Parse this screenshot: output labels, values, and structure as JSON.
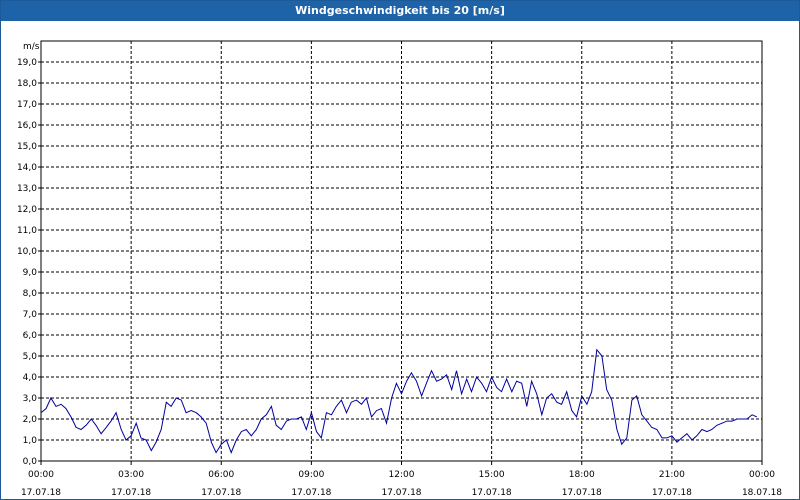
{
  "window": {
    "title": "Windgeschwindigkeit bis 20 [m/s]"
  },
  "chart_data": {
    "type": "line",
    "title": "Windgeschwindigkeit bis 20 [m/s]",
    "ylabel": "m/s",
    "ylim": [
      0,
      20
    ],
    "xlim_hours": [
      0,
      24
    ],
    "grid": true,
    "y_ticks": [
      "0,0",
      "1,0",
      "2,0",
      "3,0",
      "4,0",
      "5,0",
      "6,0",
      "7,0",
      "8,0",
      "9,0",
      "10,0",
      "11,0",
      "12,0",
      "13,0",
      "14,0",
      "15,0",
      "16,0",
      "17,0",
      "18,0",
      "19,0"
    ],
    "x_ticks": [
      {
        "time": "00:00",
        "date": "17.07.18"
      },
      {
        "time": "03:00",
        "date": "17.07.18"
      },
      {
        "time": "06:00",
        "date": "17.07.18"
      },
      {
        "time": "09:00",
        "date": "17.07.18"
      },
      {
        "time": "12:00",
        "date": "17.07.18"
      },
      {
        "time": "15:00",
        "date": "17.07.18"
      },
      {
        "time": "18:00",
        "date": "17.07.18"
      },
      {
        "time": "21:00",
        "date": "17.07.18"
      },
      {
        "time": "00:00",
        "date": "18.07.18"
      }
    ],
    "series": [
      {
        "color": "#0000a0",
        "x_hours": [
          0,
          0.17,
          0.33,
          0.5,
          0.67,
          0.83,
          1,
          1.17,
          1.33,
          1.5,
          1.67,
          1.83,
          2,
          2.17,
          2.33,
          2.5,
          2.67,
          2.83,
          3,
          3.17,
          3.33,
          3.5,
          3.67,
          3.83,
          4,
          4.17,
          4.33,
          4.5,
          4.67,
          4.83,
          5,
          5.17,
          5.33,
          5.5,
          5.67,
          5.83,
          6,
          6.17,
          6.33,
          6.5,
          6.67,
          6.83,
          7,
          7.17,
          7.33,
          7.5,
          7.67,
          7.83,
          8,
          8.17,
          8.33,
          8.5,
          8.67,
          8.83,
          9,
          9.17,
          9.33,
          9.5,
          9.67,
          9.83,
          10,
          10.17,
          10.33,
          10.5,
          10.67,
          10.83,
          11,
          11.17,
          11.33,
          11.5,
          11.67,
          11.83,
          12,
          12.17,
          12.33,
          12.5,
          12.67,
          12.83,
          13,
          13.17,
          13.33,
          13.5,
          13.67,
          13.83,
          14,
          14.17,
          14.33,
          14.5,
          14.67,
          14.83,
          15,
          15.17,
          15.33,
          15.5,
          15.67,
          15.83,
          16,
          16.17,
          16.33,
          16.5,
          16.67,
          16.83,
          17,
          17.17,
          17.33,
          17.5,
          17.67,
          17.83,
          18,
          18.17,
          18.33,
          18.5,
          18.67,
          18.83,
          19,
          19.17,
          19.33,
          19.5,
          19.67,
          19.83,
          20,
          20.17,
          20.33,
          20.5,
          20.67,
          20.83,
          21,
          21.17,
          21.33,
          21.5,
          21.67,
          21.83,
          22,
          22.17,
          22.33,
          22.5,
          22.67,
          22.83,
          23,
          23.17,
          23.33,
          23.5,
          23.67,
          23.83
        ],
        "values": [
          2.3,
          2.5,
          3.0,
          2.6,
          2.7,
          2.5,
          2.1,
          1.6,
          1.5,
          1.7,
          2.0,
          1.7,
          1.3,
          1.6,
          1.9,
          2.3,
          1.5,
          1.0,
          1.2,
          1.8,
          1.1,
          1.0,
          0.5,
          0.9,
          1.5,
          2.8,
          2.6,
          3.0,
          2.9,
          2.3,
          2.4,
          2.3,
          2.1,
          1.8,
          0.9,
          0.4,
          0.8,
          1.0,
          0.4,
          1.0,
          1.4,
          1.5,
          1.2,
          1.5,
          2.0,
          2.2,
          2.6,
          1.7,
          1.5,
          1.9,
          2.0,
          2.0,
          2.1,
          1.5,
          2.3,
          1.4,
          1.1,
          2.3,
          2.2,
          2.6,
          2.9,
          2.3,
          2.8,
          2.9,
          2.7,
          3.0,
          2.1,
          2.4,
          2.5,
          1.8,
          3.0,
          3.7,
          3.2,
          3.8,
          4.2,
          3.8,
          3.1,
          3.7,
          4.3,
          3.8,
          3.9,
          4.1,
          3.4,
          4.3,
          3.2,
          3.9,
          3.3,
          4.0,
          3.7,
          3.3,
          4.0,
          3.5,
          3.3,
          3.9,
          3.3,
          3.8,
          3.7,
          2.6,
          3.8,
          3.2,
          2.2,
          3.0,
          3.2,
          2.8,
          2.7,
          3.3,
          2.4,
          2.1,
          3.1,
          2.7,
          3.3,
          5.3,
          5.0,
          3.4,
          2.9,
          1.5,
          0.8,
          1.1,
          2.9,
          3.1,
          2.2,
          1.9,
          1.6,
          1.5,
          1.1,
          1.1,
          1.2,
          0.9,
          1.1,
          1.3,
          1.0,
          1.2,
          1.5,
          1.4,
          1.5,
          1.7,
          1.8,
          1.9,
          1.9,
          2.0,
          2.0,
          2.0,
          2.2,
          2.1,
          1.9
        ]
      }
    ]
  }
}
